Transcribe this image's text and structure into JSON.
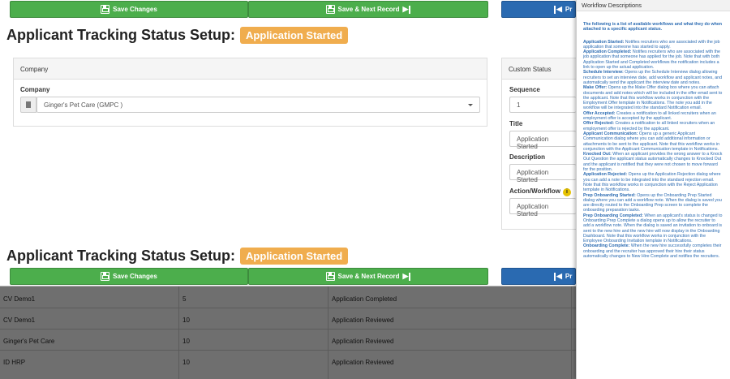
{
  "toolbar": {
    "save_label": "Save Changes",
    "save_next_label": "Save & Next Record",
    "prev_label": "Pr"
  },
  "header": {
    "title": "Applicant Tracking Status Setup:",
    "status": "Application Started"
  },
  "company_panel": {
    "heading": "Company",
    "field_label": "Company",
    "value": "Ginger's Pet Care (GMPC )"
  },
  "custom_status_panel": {
    "heading": "Custom Status",
    "sequence_label": "Sequence",
    "sequence_value": "1",
    "title_label": "Title",
    "title_value": "Application Started",
    "description_label": "Description",
    "description_value": "Application Started",
    "workflow_label": "Action/Workflow",
    "workflow_value": "Application Started"
  },
  "background_rows": [
    {
      "company": "CV Demo1",
      "sequence": "5",
      "status": "Application Completed"
    },
    {
      "company": "CV Demo1",
      "sequence": "10",
      "status": "Application Reviewed"
    },
    {
      "company": "Ginger's Pet Care",
      "sequence": "10",
      "status": "Application Reviewed"
    },
    {
      "company": "ID HRP",
      "sequence": "10",
      "status": "Application Reviewed"
    }
  ],
  "workflow_popup": {
    "title": "Workflow Descriptions",
    "intro": "The following is a list of available workflows and what they do when attached to a specific applicant status.",
    "items": [
      {
        "name": "Application Started:",
        "text": " Notifies recruiters who are associated with the job application that someone has started to apply."
      },
      {
        "name": "Application Completed:",
        "text": " Notifies recruiters who are associated with the job application that someone has applied for the job. Note that with both Application Started and Completed workflows the notification includes a link to open up the actual application."
      },
      {
        "name": "Schedule Interview:",
        "text": " Opens up the Schedule Interview dialog allowing recruiters to set an interview date, add workflow and applicant notes, and automatically send the applicant the interview date and notes."
      },
      {
        "name": "Make Offer:",
        "text": " Opens up the Make Offer dialog box where you can attach documents and add notes which will be included in the offer email sent to the applicant. Note that this workflow works in conjunction with the Employment Offer template in Notifications. The note you add in the workflow will be integrated into the standard Notification email."
      },
      {
        "name": "Offer Accepted:",
        "text": " Creates a notification to all linked recruiters when an employment offer is accepted by the applicant."
      },
      {
        "name": "Offer Rejected:",
        "text": " Creates a notification to all linked recruiters when an employment offer is rejected by the applicant."
      },
      {
        "name": "Applicant Communication:",
        "text": " Opens up a generic Applicant Communication dialog where you can add additional information or attachments to be sent to the applicant. Note that this workflow works in conjunction with the Applicant Communication template in Notifications."
      },
      {
        "name": "Knocked Out:",
        "text": " When an applicant provides the wrong answer to a Knock Out Question the applicant status automatically changes to Knocked Out and the applicant is notified that they were not chosen to move forward for the position."
      },
      {
        "name": "Application Rejected:",
        "text": " Opens up the Application Rejection dialog where you can add a note to be integrated into the standard rejection email. Note that this workflow works in conjunction with the Reject Application template in Notifications."
      },
      {
        "name": "Prep Onboarding Started:",
        "text": " Opens up the Onboarding Prep Started dialog where you can add a workflow note. When the dialog is saved you are directly routed to the Onboarding Prep screen to complete the onboarding preparation tasks."
      },
      {
        "name": "Prep Onboarding Completed:",
        "text": " When an applicant's status is changed to Onboarding Prep Complete a dialog opens up to allow the recruiter to add a workflow note. When the dialog is saved an invitation to onboard is sent to the new hire and the new hire will now display in the Onboarding Dashboard. Note that this workflow works in conjunction with the Employee Onboarding Invitation template in Notifications."
      },
      {
        "name": "Onboarding Complete:",
        "text": " When the new hire successfully completes their onboarding and the recruiter has approved their hire their status automatically changes to New Hire Complete and notifies the recruiters."
      }
    ]
  },
  "colors": {
    "green": "#4cae4c",
    "blue": "#2a6ab1",
    "badge": "#f0ad4e",
    "popup_text": "#2a6ab1"
  }
}
